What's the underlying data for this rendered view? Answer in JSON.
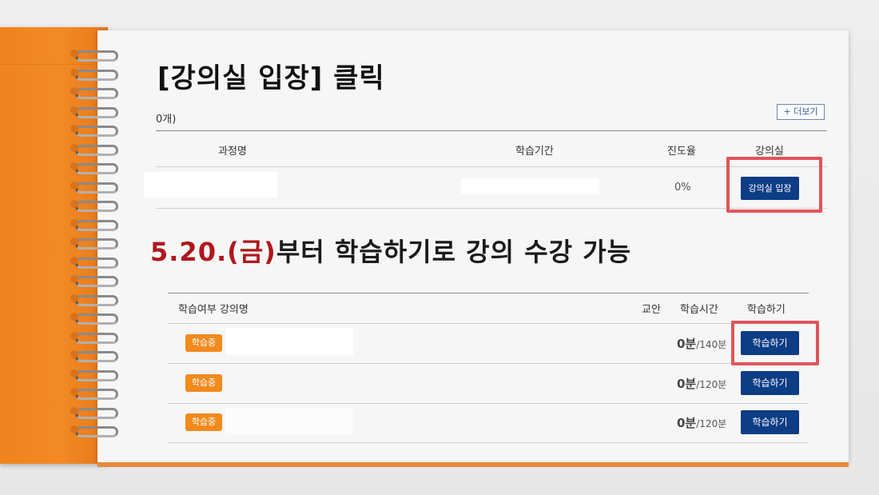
{
  "title": "[강의실 입장] 클릭",
  "panel1": {
    "cut_label": "0개)",
    "more_button": "+ 더보기",
    "headers": {
      "course": "과정명",
      "period": "학습기간",
      "progress": "진도율",
      "classroom": "강의실"
    },
    "row": {
      "progress": "0%",
      "enter_button": "강의실 입장"
    }
  },
  "headline": {
    "date": "5.20.",
    "day": "(금)",
    "rest": "부터 학습하기로 강의 수강 가능"
  },
  "panel2": {
    "headers": {
      "status_name": "학습여부  강의명",
      "material": "교안",
      "time": "학습시간",
      "study": "학습하기"
    },
    "rows": [
      {
        "status": "학습중",
        "time_done": "0분",
        "time_total": "/140분",
        "button": "학습하기"
      },
      {
        "status": "학습중",
        "time_done": "0분",
        "time_total": "/120분",
        "button": "학습하기"
      },
      {
        "status": "학습중",
        "time_done": "0분",
        "time_total": "/120분",
        "button": "학습하기"
      }
    ]
  },
  "colors": {
    "accent_blue": "#0c3d85",
    "badge_orange": "#f28a1d",
    "highlight_red": "#e0555b",
    "cover_orange": "#f0841f",
    "headline_red": "#b0171c"
  }
}
